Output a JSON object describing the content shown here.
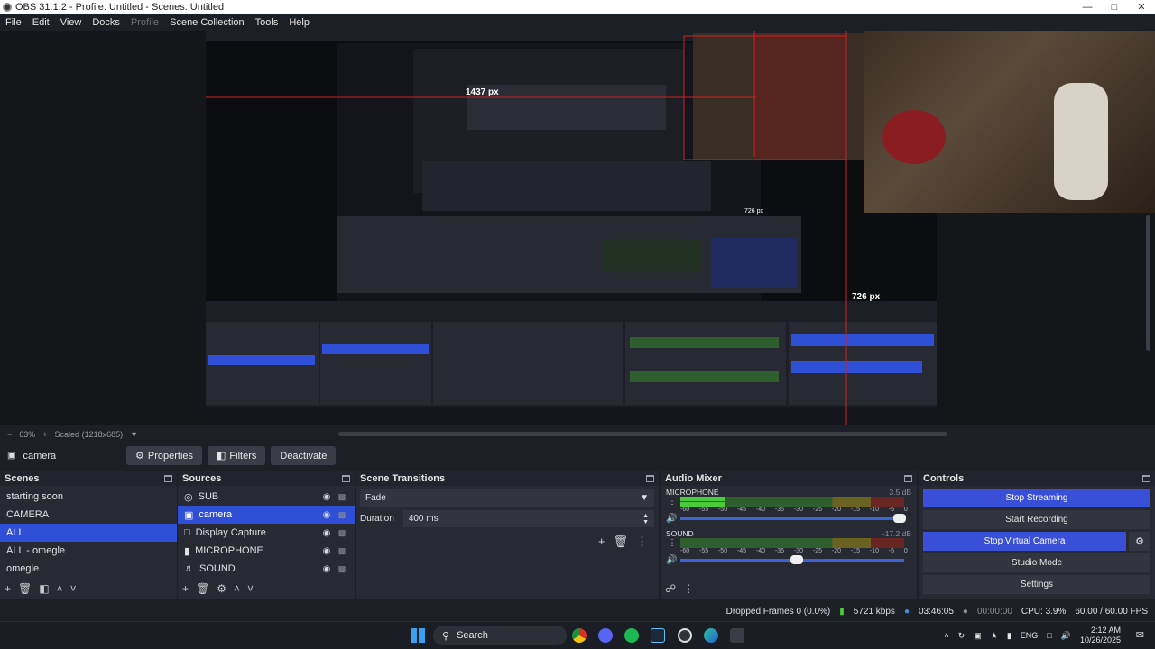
{
  "window": {
    "title": "OBS 31.1.2 - Profile: Untitled - Scenes: Untitled"
  },
  "menu": [
    "File",
    "Edit",
    "View",
    "Docks",
    "Profile",
    "Scene Collection",
    "Tools",
    "Help"
  ],
  "preview": {
    "measure_h": "1437 px",
    "measure_v1": "726 px",
    "measure_v2": "726 px"
  },
  "scale": {
    "zoom": "63%",
    "scaled": "Scaled (1218x685)"
  },
  "source_toolbar": {
    "name": "camera",
    "properties": "Properties",
    "filters": "Filters",
    "deactivate": "Deactivate"
  },
  "scenes": {
    "title": "Scenes",
    "items": [
      "starting soon",
      "CAMERA",
      "ALL",
      "ALL - omegle",
      "omegle"
    ],
    "selected": 2
  },
  "sources": {
    "title": "Sources",
    "items": [
      {
        "name": "SUB",
        "icon": "globe-icon"
      },
      {
        "name": "camera",
        "icon": "camera-icon"
      },
      {
        "name": "Display Capture",
        "icon": "monitor-icon"
      },
      {
        "name": "MICROPHONE",
        "icon": "microphone-icon"
      },
      {
        "name": "SOUND",
        "icon": "speaker-icon"
      }
    ],
    "selected": 1
  },
  "transitions": {
    "title": "Scene Transitions",
    "type": "Fade",
    "duration_label": "Duration",
    "duration": "400 ms"
  },
  "mixer": {
    "title": "Audio Mixer",
    "channels": [
      {
        "name": "MICROPHONE",
        "db": "3.5 dB",
        "level": 0.2,
        "volume": 0.98
      },
      {
        "name": "SOUND",
        "db": "-17.2 dB",
        "level": 0.0,
        "volume": 0.52
      }
    ],
    "ticks": [
      "-60",
      "-55",
      "-50",
      "-45",
      "-40",
      "-35",
      "-30",
      "-25",
      "-20",
      "-15",
      "-10",
      "-5",
      "0"
    ]
  },
  "controls": {
    "title": "Controls",
    "stop_streaming": "Stop Streaming",
    "start_recording": "Start Recording",
    "stop_virtual_camera": "Stop Virtual Camera",
    "studio_mode": "Studio Mode",
    "settings": "Settings"
  },
  "status": {
    "dropped": "Dropped Frames 0 (0.0%)",
    "bitrate": "5721 kbps",
    "stream_time": "03:46:05",
    "rec_time": "00:00:00",
    "cpu": "CPU: 3.9%",
    "fps": "60.00 / 60.00 FPS"
  },
  "taskbar": {
    "search": "Search",
    "lang": "ENG",
    "time": "2:12 AM",
    "date": "10/26/2025"
  },
  "colors": {
    "accent": "#2f4fd7",
    "panel": "#272a33",
    "bg": "#1d1f26"
  }
}
